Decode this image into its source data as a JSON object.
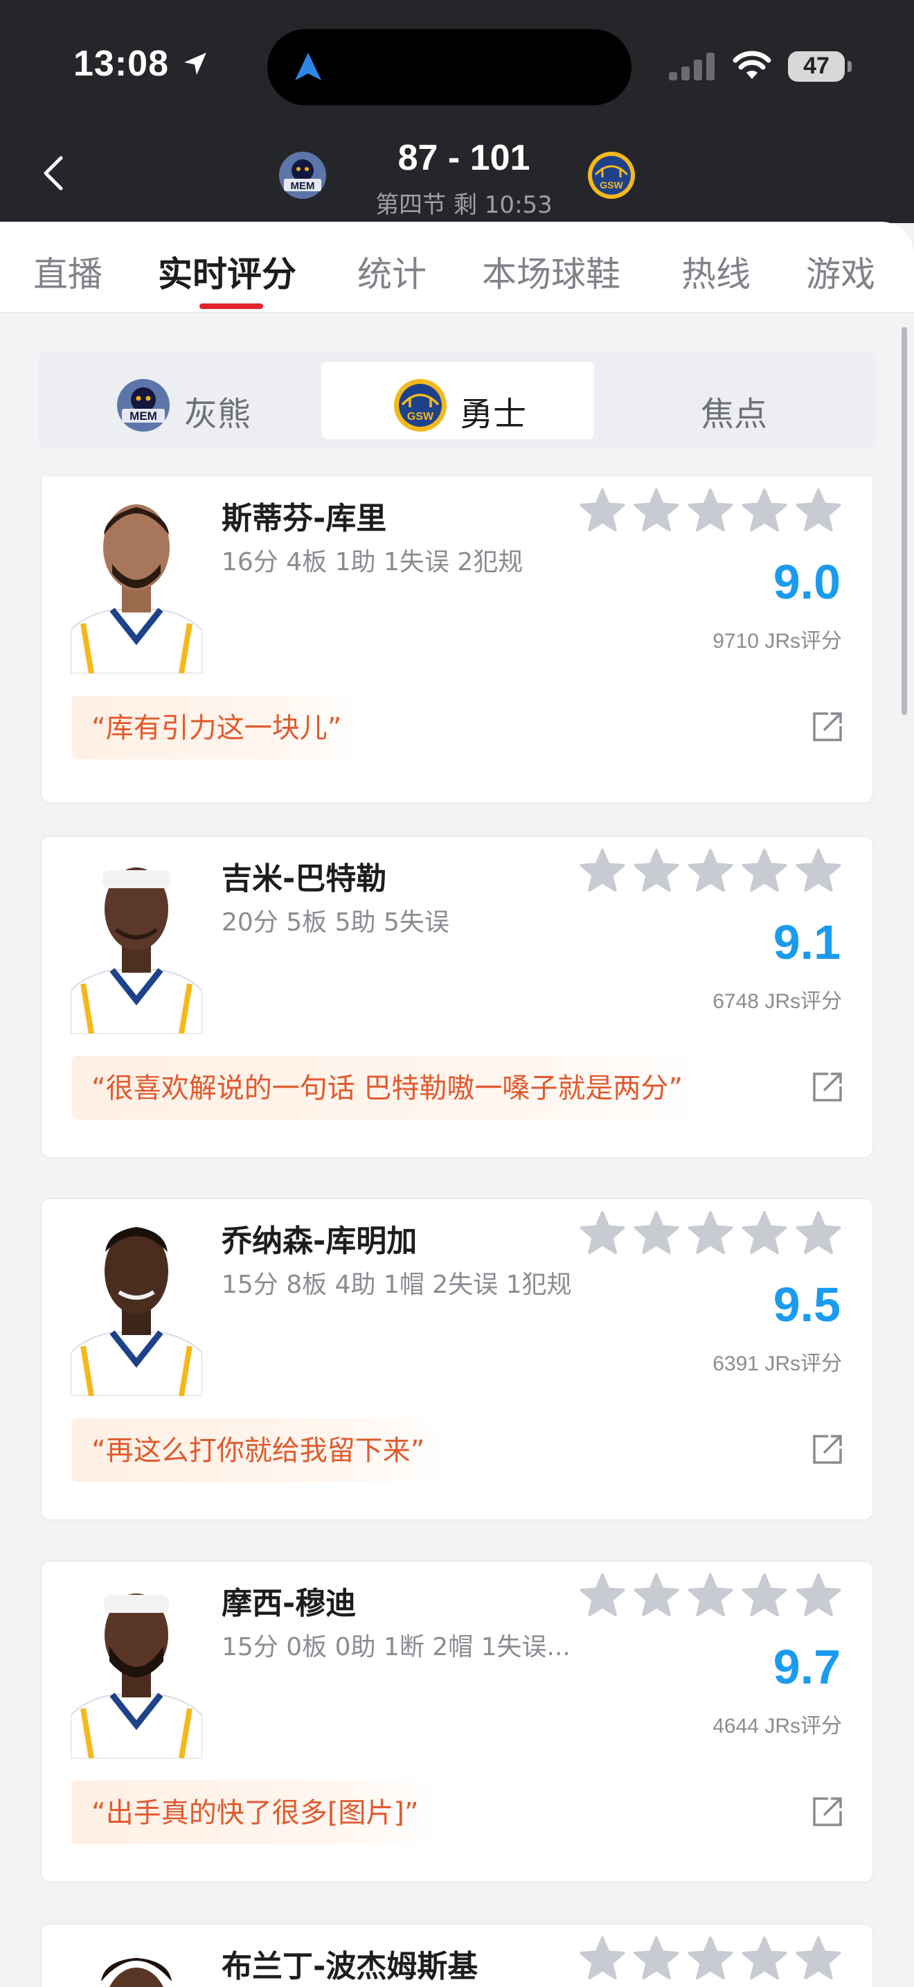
{
  "status_bar": {
    "time": "13:08",
    "battery": "47"
  },
  "header": {
    "score": "87 - 101",
    "period": "第四节 剩 10:53",
    "home_team_abbr": "MEM",
    "away_team_abbr": "GSW"
  },
  "tabs": [
    {
      "label": "直播",
      "active": false
    },
    {
      "label": "实时评分",
      "active": true
    },
    {
      "label": "统计",
      "active": false
    },
    {
      "label": "本场球鞋",
      "active": false
    },
    {
      "label": "热线",
      "active": false
    },
    {
      "label": "游戏",
      "active": false
    }
  ],
  "segment": [
    {
      "label": "灰熊",
      "logo": "MEM",
      "active": false
    },
    {
      "label": "勇士",
      "logo": "GSW",
      "active": true
    },
    {
      "label": "焦点",
      "logo": "",
      "active": false
    }
  ],
  "players": [
    {
      "name": "斯蒂芬-库里",
      "stats": "16分 4板 1助 1失误 2犯规",
      "rating": "9.0",
      "votes": "9710 JRs评分",
      "quote": "“库有引力这一块儿”"
    },
    {
      "name": "吉米-巴特勒",
      "stats": "20分 5板 5助 5失误",
      "rating": "9.1",
      "votes": "6748 JRs评分",
      "quote": "“很喜欢解说的一句话 巴特勒嗷一嗓子就是两分”"
    },
    {
      "name": "乔纳森-库明加",
      "stats": "15分 8板 4助 1帽 2失误 1犯规",
      "rating": "9.5",
      "votes": "6391 JRs评分",
      "quote": "“再这么打你就给我留下来”"
    },
    {
      "name": "摩西-穆迪",
      "stats": "15分 0板 0助 1断 2帽 1失误...",
      "rating": "9.7",
      "votes": "4644 JRs评分",
      "quote": "“出手真的快了很多[图片]”"
    },
    {
      "name": "布兰丁-波杰姆斯基",
      "stats": "",
      "rating": "",
      "votes": "",
      "quote": ""
    }
  ],
  "colors": {
    "header_bg": "#25262a",
    "tab_indicator": "#e0232c",
    "rating_blue": "#1a9bef",
    "quote_orange": "#e05a2e",
    "star_gray": "#c9cbd2"
  }
}
